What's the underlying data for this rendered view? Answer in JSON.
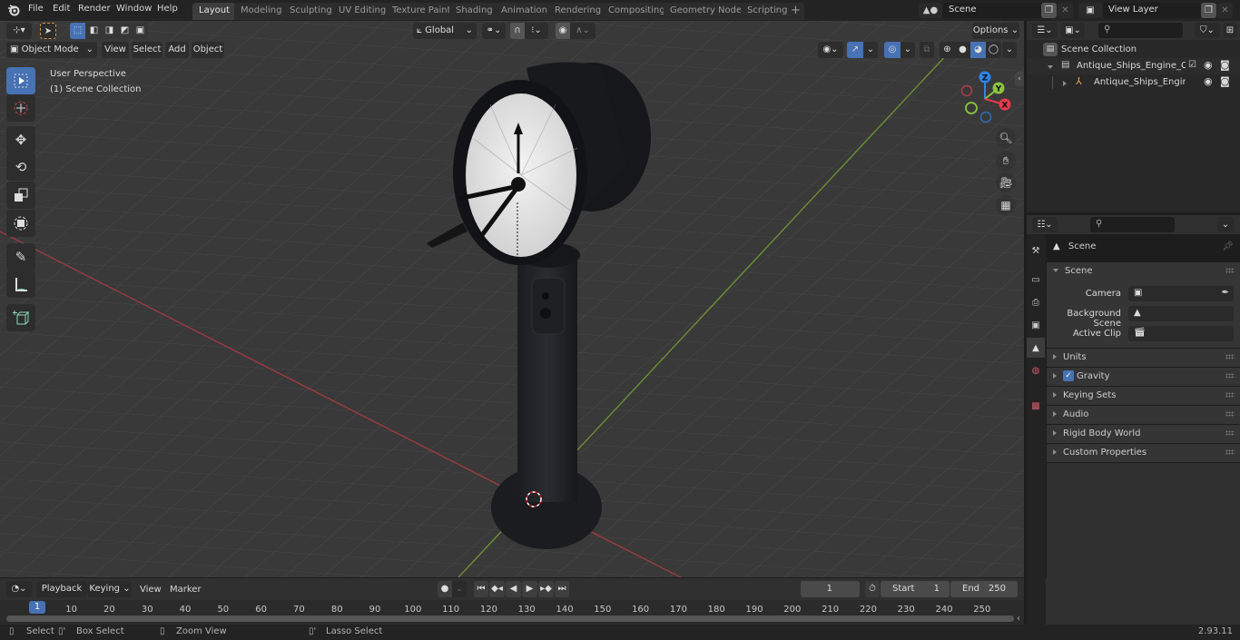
{
  "topbar": {
    "menu": [
      "File",
      "Edit",
      "Render",
      "Window",
      "Help"
    ],
    "workspaces": [
      "Layout",
      "Modeling",
      "Sculpting",
      "UV Editing",
      "Texture Paint",
      "Shading",
      "Animation",
      "Rendering",
      "Compositing",
      "Geometry Nodes",
      "Scripting"
    ],
    "active_workspace": "Layout",
    "add_tab_label": "+",
    "scene_name": "Scene",
    "view_layer_name": "View Layer"
  },
  "viewport": {
    "mode": "Object Mode",
    "menus": [
      "View",
      "Select",
      "Add",
      "Object"
    ],
    "transform_orientation": "Global",
    "options_label": "Options",
    "overlay_title": "User Perspective",
    "overlay_subtitle": "(1) Scene Collection",
    "gizmo_axes": {
      "x": "X",
      "y": "Y",
      "z": "Z"
    },
    "axis_colors": {
      "x": "#e8394e",
      "y": "#8bc43f",
      "z": "#2f83e6"
    },
    "tools": [
      "select-box",
      "cursor",
      "move",
      "rotate",
      "scale",
      "transform",
      "annotate",
      "measure",
      "add-cube"
    ],
    "nav_buttons": [
      "zoom",
      "pan",
      "camera",
      "ortho-grid"
    ]
  },
  "outliner": {
    "root": "Scene Collection",
    "items": [
      {
        "label": "Antique_Ships_Engine_Contrc",
        "type": "collection",
        "checked": true
      },
      {
        "label": "Antique_Ships_Engine_Cc",
        "type": "object"
      }
    ]
  },
  "properties": {
    "context_label": "Scene",
    "panel_title": "Scene",
    "fields": [
      {
        "label": "Camera",
        "value": ""
      },
      {
        "label": "Background Scene",
        "value": ""
      },
      {
        "label": "Active Clip",
        "value": ""
      }
    ],
    "subpanels": [
      {
        "label": "Units"
      },
      {
        "label": "Gravity",
        "checkbox": true
      },
      {
        "label": "Keying Sets"
      },
      {
        "label": "Audio"
      },
      {
        "label": "Rigid Body World"
      },
      {
        "label": "Custom Properties"
      }
    ],
    "tabs": [
      "tool",
      "render",
      "output",
      "view-layer",
      "scene",
      "world",
      "texture"
    ]
  },
  "timeline": {
    "menus": [
      "Playback",
      "Keying",
      "View",
      "Marker"
    ],
    "current_frame": "1",
    "start_label": "Start",
    "start_value": "1",
    "end_label": "End",
    "end_value": "250",
    "frame_ticks": [
      "10",
      "20",
      "30",
      "40",
      "50",
      "60",
      "70",
      "80",
      "90",
      "100",
      "110",
      "120",
      "130",
      "140",
      "150",
      "160",
      "170",
      "180",
      "190",
      "200",
      "210",
      "220",
      "230",
      "240",
      "250"
    ],
    "playhead_label": "1"
  },
  "statusbar": {
    "hints": [
      "Select",
      "Box Select",
      "Zoom View",
      "Lasso Select"
    ],
    "version": "2.93.11"
  }
}
